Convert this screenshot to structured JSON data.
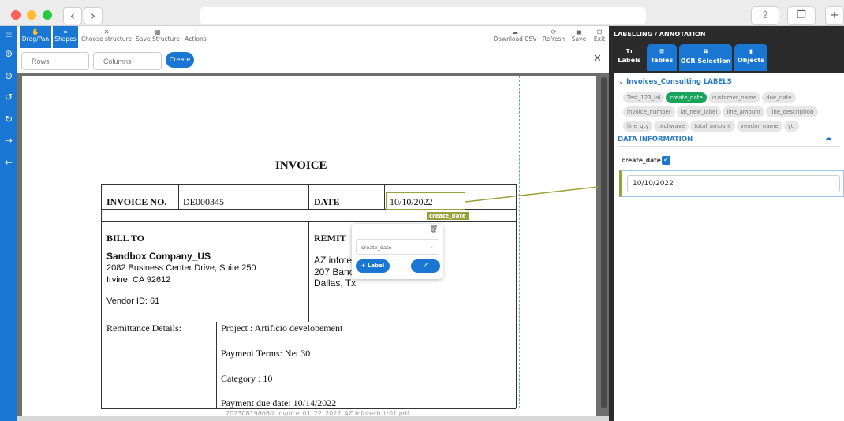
{
  "browser": {
    "back_icon": "‹",
    "forward_icon": "›",
    "share_icon": "share-icon",
    "tabs_icon": "tabs-icon",
    "new_tab_icon": "+"
  },
  "sidebar": {
    "icons": [
      "menu-icon",
      "zoom-in-icon",
      "zoom-out-icon",
      "rotate-left-icon",
      "rotate-right-icon",
      "arrow-right-icon",
      "arrow-left-icon"
    ]
  },
  "toolbar": {
    "drag_pan": "Drag/Pan",
    "shapes": "Shapes",
    "choose_structure": "Choose structure",
    "save_structure": "Save Structure",
    "actions": "Actions",
    "download_csv": "Download CSV",
    "refresh": "Refresh",
    "save": "Save",
    "exit": "Exit"
  },
  "table_form": {
    "rows_placeholder": "Rows",
    "columns_placeholder": "Columns",
    "create": "Create",
    "close": "✕"
  },
  "invoice": {
    "title": "INVOICE",
    "invoice_no_label": "INVOICE NO.",
    "invoice_no": "DE000345",
    "date_label": "DATE",
    "date": "10/10/2022",
    "bill_to_label": "BILL TO",
    "remit_label": "REMIT",
    "bill_company": "Sandbox Company_US",
    "bill_addr1": "2082 Business Center Drive, Suite 250",
    "bill_addr2": "Irvine, CA 92612",
    "vendor_id": "Vendor ID: 61",
    "remit_line1": "AZ infote",
    "remit_line2": "207 Banc",
    "remit_line3": "Dallas, Tx",
    "remittance_label": "Remittance Details:",
    "project": "Project : Artificio developement",
    "payment_terms": "Payment Terms: Net 30",
    "category": "Category : 10",
    "due_date": "Payment due date: 10/14/2022",
    "filename": "202308198060_Invoice_01_22_2022_AZ Infotech_tr01.pdf"
  },
  "annotation": {
    "tag": "create_date",
    "select_value": "create_date",
    "add_label": "+ Label",
    "confirm_icon": "✓",
    "delete_icon": "trash-icon",
    "accent": "#9aa03a"
  },
  "panel": {
    "title": "LABELLING / ANNOTATION",
    "tabs": [
      {
        "label": "Labels",
        "icon": "Tт"
      },
      {
        "label": "Tables",
        "icon": "⊞"
      },
      {
        "label": "OCR Selection",
        "icon": "⧉"
      },
      {
        "label": "Objects",
        "icon": "▮"
      }
    ],
    "group": "Invoices_Consulting LABELS",
    "labels": [
      "Test_123_lal",
      "create_date",
      "customer_name",
      "due_date",
      "invoice_number",
      "lal_new_label",
      "line_amount",
      "line_description",
      "line_qty",
      "techwave",
      "total_amount",
      "vendor_name",
      "ytr"
    ],
    "active_label": "create_date",
    "data_info": "DATA INFORMATION",
    "field_label": "create_date",
    "field_checked": true,
    "field_value": "10/10/2022"
  },
  "colors": {
    "primary": "#1976d2",
    "active_chip": "#1aa35d",
    "panel_bg": "#2b2b2b"
  }
}
